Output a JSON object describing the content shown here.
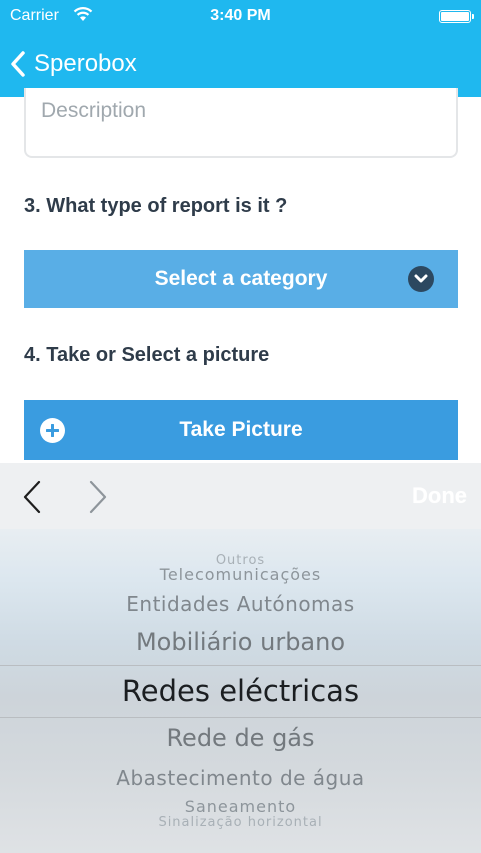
{
  "status_bar": {
    "carrier": "Carrier",
    "time": "3:40 PM"
  },
  "nav": {
    "back_label": "Sperobox"
  },
  "form": {
    "description_placeholder": "Description",
    "question3": "3. What type of report is it ?",
    "category_button": "Select a category",
    "question4": "4. Take or Select a picture",
    "picture_button": "Take Picture"
  },
  "toolbar": {
    "done_label": "Done"
  },
  "picker": {
    "options": [
      "Outros",
      "Telecomunicações",
      "Entidades Autónomas",
      "Mobiliário urbano",
      "Redes eléctricas",
      "Rede de gás",
      "Abastecimento de água",
      "Saneamento",
      "Sinalização horizontal"
    ],
    "selected": "Redes eléctricas"
  },
  "colors": {
    "nav_bar": "#1fb8ef",
    "category_button": "#59aee6",
    "picture_button": "#3a9ce0",
    "question_text": "#2f3c4a"
  },
  "icons": {
    "wifi": "wifi-icon",
    "battery": "battery-icon",
    "back": "chevron-left-icon",
    "dropdown": "chevron-down-circle-icon",
    "add": "plus-circle-icon",
    "prev": "chevron-left-icon",
    "next": "chevron-right-icon"
  }
}
